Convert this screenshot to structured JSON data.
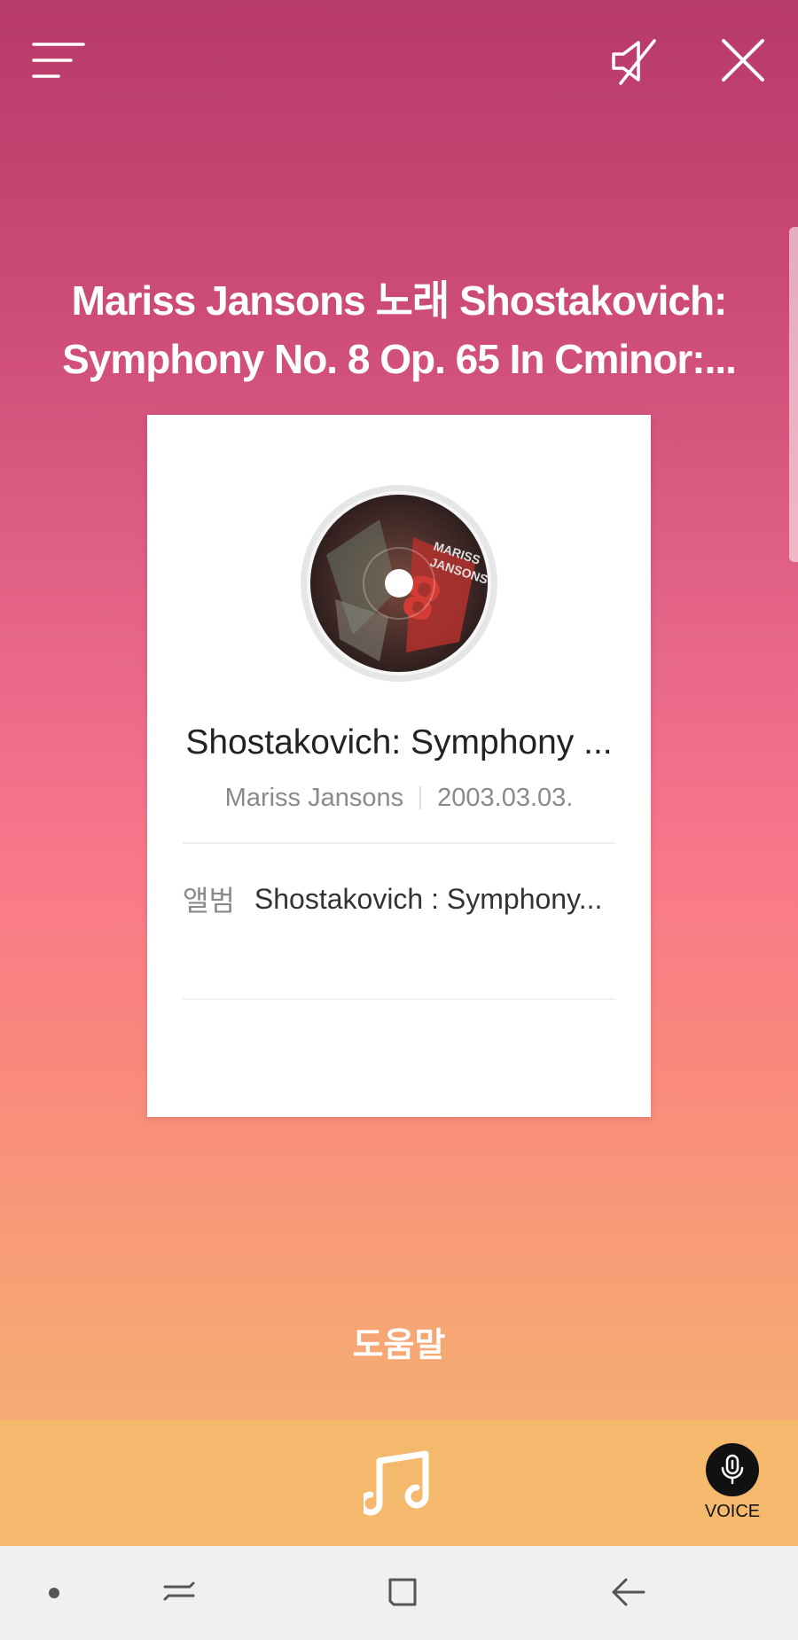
{
  "heading": {
    "line1": "Mariss Jansons 노래 Shostakovich:",
    "line2": "Symphony No. 8 Op. 65 In Cminor:..."
  },
  "card": {
    "song_title": "Shostakovich: Symphony ...",
    "artist": "Mariss Jansons",
    "release_date": "2003.03.03.",
    "album_label": "앨범",
    "album_value": "Shostakovich : Symphony..."
  },
  "help_link": "도움말",
  "voice_label": "VOICE",
  "colors": {
    "gradient_top": "#b83a6a",
    "gradient_mid": "#f9778a",
    "gradient_bottom": "#f3b772",
    "panel": "#f4b96d",
    "nav_bar": "#f0f0f0"
  },
  "icons": {
    "menu": "menu-icon",
    "mute": "sound-off-icon",
    "close": "close-icon",
    "album_art": "album-disc-icon",
    "music": "music-note-icon",
    "voice": "microphone-icon",
    "nav_recents": "recents-icon",
    "nav_home": "home-icon",
    "nav_back": "back-icon"
  }
}
